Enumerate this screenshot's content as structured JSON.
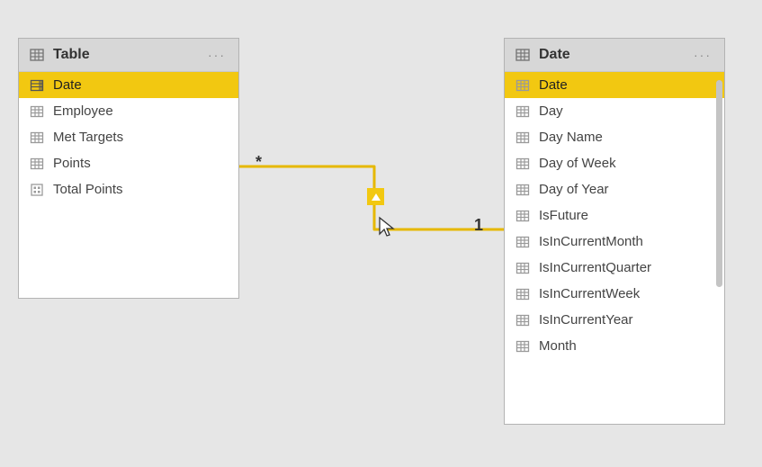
{
  "colors": {
    "accent": "#f2c811",
    "relationship_line": "#e6b800"
  },
  "relationship": {
    "from_entity": "Table",
    "to_entity": "Date",
    "from_cardinality": "*",
    "to_cardinality": "1",
    "filter_direction": "single"
  },
  "entities": {
    "table": {
      "title": "Table",
      "menu_glyph": "···",
      "fields": [
        {
          "name": "Date",
          "kind": "calc",
          "selected": true
        },
        {
          "name": "Employee",
          "kind": "column",
          "selected": false
        },
        {
          "name": "Met Targets",
          "kind": "column",
          "selected": false
        },
        {
          "name": "Points",
          "kind": "column",
          "selected": false
        },
        {
          "name": "Total Points",
          "kind": "measure",
          "selected": false
        }
      ]
    },
    "date": {
      "title": "Date",
      "menu_glyph": "···",
      "fields": [
        {
          "name": "Date",
          "kind": "column",
          "selected": true
        },
        {
          "name": "Day",
          "kind": "column",
          "selected": false
        },
        {
          "name": "Day Name",
          "kind": "column",
          "selected": false
        },
        {
          "name": "Day of Week",
          "kind": "column",
          "selected": false
        },
        {
          "name": "Day of Year",
          "kind": "column",
          "selected": false
        },
        {
          "name": "IsFuture",
          "kind": "column",
          "selected": false
        },
        {
          "name": "IsInCurrentMonth",
          "kind": "column",
          "selected": false
        },
        {
          "name": "IsInCurrentQuarter",
          "kind": "column",
          "selected": false
        },
        {
          "name": "IsInCurrentWeek",
          "kind": "column",
          "selected": false
        },
        {
          "name": "IsInCurrentYear",
          "kind": "column",
          "selected": false
        },
        {
          "name": "Month",
          "kind": "column",
          "selected": false
        }
      ]
    }
  }
}
